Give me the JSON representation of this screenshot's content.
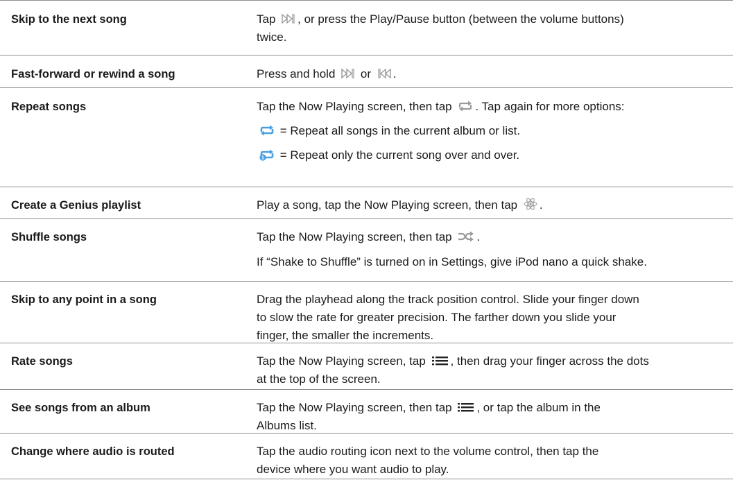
{
  "table": {
    "rows": [
      {
        "task": "Skip to the next song",
        "lines": [
          [
            {
              "t": "Tap "
            },
            {
              "icon": "next-track-icon"
            },
            {
              "t": ", or press the Play/Pause button (between the volume buttons)"
            }
          ],
          [
            {
              "t": "twice."
            }
          ]
        ]
      },
      {
        "task": "Fast-forward or rewind a song",
        "lines": [
          [
            {
              "t": "Press and hold "
            },
            {
              "icon": "next-track-icon"
            },
            {
              "t": " or "
            },
            {
              "icon": "previous-track-icon"
            },
            {
              "t": "."
            }
          ]
        ]
      },
      {
        "task": "Repeat songs",
        "lines": [
          [
            {
              "t": "Tap the Now Playing screen, then tap "
            },
            {
              "icon": "repeat-icon"
            },
            {
              "t": ". Tap again for more options:"
            }
          ],
          [
            {
              "icon": "repeat-all-icon"
            },
            {
              "t": " = Repeat all songs in the current album or list."
            }
          ],
          [
            {
              "icon": "repeat-one-icon"
            },
            {
              "t": " = Repeat only the current song over and over."
            }
          ]
        ]
      },
      {
        "task": "Create a Genius playlist",
        "lines": [
          [
            {
              "t": "Play a song, tap the Now Playing screen, then tap "
            },
            {
              "icon": "genius-icon"
            },
            {
              "t": "."
            }
          ]
        ]
      },
      {
        "task": "Shuffle songs",
        "lines": [
          [
            {
              "t": "Tap the Now Playing screen, then tap "
            },
            {
              "icon": "shuffle-icon"
            },
            {
              "t": "."
            }
          ],
          [
            {
              "t": "If “Shake to Shuffle” is turned on in Settings, give iPod nano a quick shake."
            }
          ]
        ]
      },
      {
        "task": "Skip to any point in a song",
        "lines": [
          [
            {
              "t": "Drag the playhead along the track position control. Slide your finger down"
            }
          ],
          [
            {
              "t": "to slow the rate for greater precision. The farther down you slide your"
            }
          ],
          [
            {
              "t": "finger, the smaller the increments."
            }
          ]
        ]
      },
      {
        "task": "Rate songs",
        "lines": [
          [
            {
              "t": "Tap the Now Playing screen, tap "
            },
            {
              "icon": "list-icon"
            },
            {
              "t": ", then drag your finger across the dots"
            }
          ],
          [
            {
              "t": "at the top of the screen."
            }
          ]
        ]
      },
      {
        "task": "See songs from an album",
        "lines": [
          [
            {
              "t": "Tap the Now Playing screen, then tap "
            },
            {
              "icon": "list-icon"
            },
            {
              "t": ", or tap the album in the"
            }
          ],
          [
            {
              "t": "Albums list."
            }
          ]
        ]
      },
      {
        "task": "Change where audio is routed",
        "lines": [
          [
            {
              "t": "Tap the audio routing icon next to the volume control, then tap the"
            }
          ],
          [
            {
              "t": "device where you want audio to play."
            }
          ]
        ]
      }
    ]
  },
  "colors": {
    "rule": "#8f8f8f",
    "text": "#1a1a1a",
    "icon_gray": "#9a9a9a",
    "repeat_blue": "#4a9fe0"
  }
}
